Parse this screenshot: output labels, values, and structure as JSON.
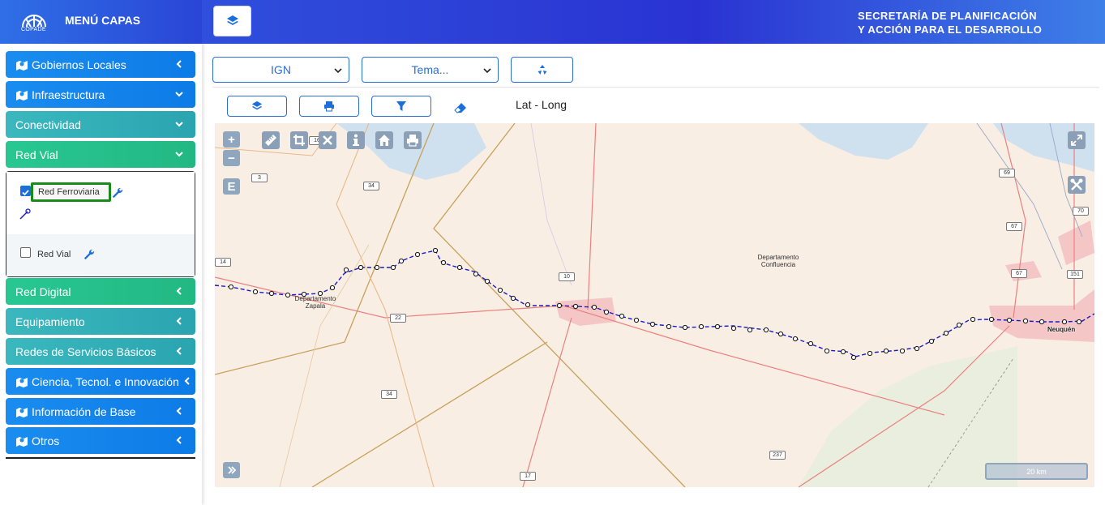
{
  "sidebar": {
    "logo_text": "COPADE",
    "title": "MENÚ CAPAS",
    "items": [
      {
        "label": "Gobiernos Locales",
        "expanded": false
      },
      {
        "label": "Infraestructura",
        "expanded": true
      },
      {
        "label": "Conectividad",
        "expanded": true
      },
      {
        "label": "Red Vial",
        "expanded": true
      },
      {
        "label": "Red Digital",
        "expanded": false
      },
      {
        "label": "Equipamiento",
        "expanded": false
      },
      {
        "label": "Redes de Servicios Básicos",
        "expanded": false
      },
      {
        "label": "Ciencia, Tecnol. e Innovación",
        "expanded": false
      },
      {
        "label": "Información de Base",
        "expanded": false
      },
      {
        "label": "Otros",
        "expanded": false
      }
    ],
    "layers": [
      {
        "label": "Red Ferroviaria",
        "checked": true
      },
      {
        "label": "Red Vial",
        "checked": false
      }
    ]
  },
  "header": {
    "title_line1": "SECRETARÍA DE PLANIFICACIÓN",
    "title_line2": "Y ACCIÓN PARA EL DESARROLLO"
  },
  "controls": {
    "basemap_select": "IGN",
    "theme_select": "Tema...",
    "coords_label": "Lat - Long"
  },
  "map": {
    "labels": {
      "zapala": "Departamento\nZapala",
      "confluencia": "Departamento\nConfluencia",
      "neuquen": "Neuquén"
    },
    "route_shields": [
      "3",
      "16",
      "34",
      "14",
      "10",
      "22",
      "34",
      "17",
      "237",
      "69",
      "70",
      "67",
      "67",
      "151"
    ],
    "scale": "20 km",
    "edit_control": "E"
  },
  "colors": {
    "header_blue": "#2a33d2",
    "menu_blue": "#1a8df0",
    "menu_teal": "#2aa5b0",
    "menu_green": "#22b884",
    "railway": "#1a1ac8",
    "highlight_border": "#1a8a1a"
  }
}
